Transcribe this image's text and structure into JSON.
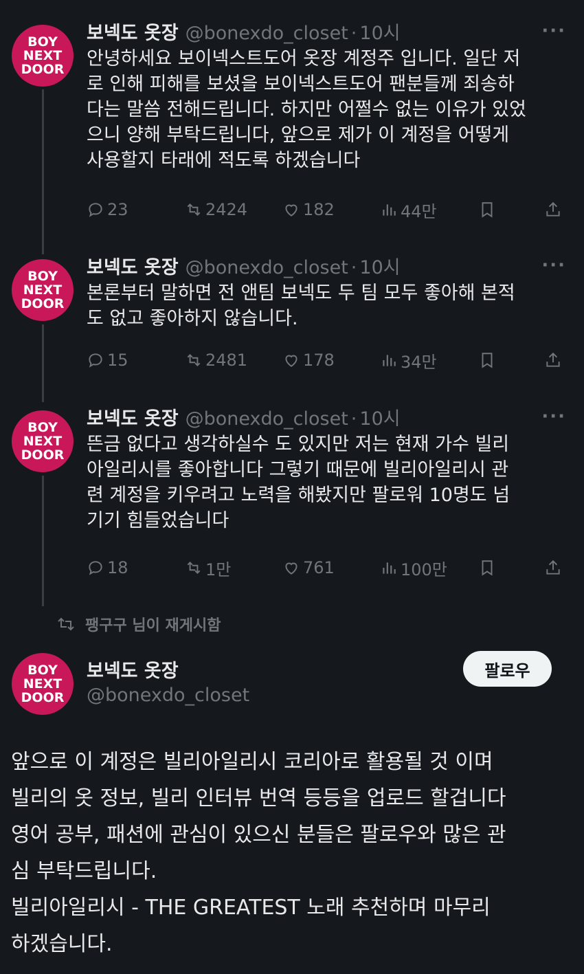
{
  "avatar_logo_text": "BOY NEXT DOOR",
  "thread": [
    {
      "name": "보넥도 옷장",
      "handle": "@bonexdo_closet",
      "time": "10시",
      "text": "안녕하세요 보이넥스트도어 옷장 계정주 입니다. 일단 저\n로 인해 피해를 보셨을 보이넥스트도어 팬분들께 죄송하\n다는 말씀 전해드립니다. 하지만 어쩔수 없는 이유가 있었\n으니 양해 부탁드립니다, 앞으로 제가 이 계정을 어떻게\n사용할지 타래에 적도록 하겠습니다",
      "replies": "23",
      "retweets": "2424",
      "likes": "182",
      "views": "44만"
    },
    {
      "name": "보넥도 옷장",
      "handle": "@bonexdo_closet",
      "time": "10시",
      "text": "본론부터 말하면 전 앤팀 보넥도 두 팀 모두 좋아해 본적\n도 없고 좋아하지 않습니다.",
      "replies": "15",
      "retweets": "2481",
      "likes": "178",
      "views": "34만"
    },
    {
      "name": "보넥도 옷장",
      "handle": "@bonexdo_closet",
      "time": "10시",
      "text": "뜬금 없다고 생각하실수 도 있지만 저는 현재 가수 빌리\n아일리시를 좋아합니다 그렇기 때문에 빌리아일리시 관\n련 계정을 키우려고 노력을 해봤지만 팔로워 10명도 넘\n기기 힘들었습니다",
      "replies": "18",
      "retweets": "1만",
      "likes": "761",
      "views": "100만"
    }
  ],
  "retweet_note": "팽구구 님이 재게시함",
  "main": {
    "name": "보넥도 옷장",
    "handle": "@bonexdo_closet",
    "follow_label": "팔로우",
    "text": "앞으로 이 계정은 빌리아일리시 코리아로 활용될 것 이며\n빌리의 옷 정보, 빌리 인터뷰 번역 등등을 업로드 할겁니다\n영어 공부, 패션에 관심이 있으신 분들은 팔로우와 많은 관\n심 부탁드립니다.\n빌리아일리시 - THE GREATEST 노래 추천하며 마무리\n하겠습니다."
  },
  "colors": {
    "background": "#15181c",
    "text": "#e7e9ea",
    "muted": "#71767b",
    "avatar": "#c8185a",
    "follow_bg": "#eff3f4"
  }
}
